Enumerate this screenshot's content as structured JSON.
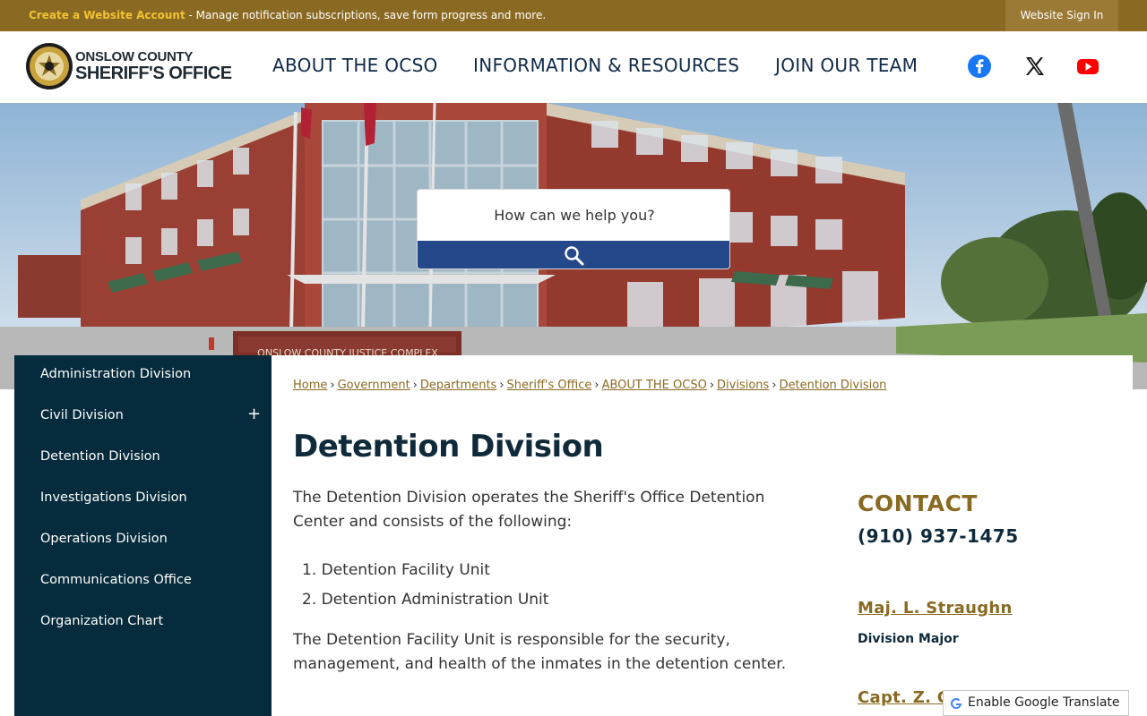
{
  "topbar": {
    "create_link": "Create a Website Account",
    "message": " - Manage notification subscriptions, save form progress and more.",
    "sign_in": "Website Sign In"
  },
  "header": {
    "logo_line1": "ONSLOW COUNTY",
    "logo_line2": "SHERIFF'S OFFICE",
    "nav": [
      "ABOUT THE OCSO",
      "INFORMATION & RESOURCES",
      "JOIN OUR TEAM"
    ],
    "social_icons": [
      "facebook-icon",
      "x-icon",
      "youtube-icon"
    ]
  },
  "hero": {
    "sign_text": "ONSLOW COUNTY JUSTICE COMPLEX"
  },
  "search": {
    "placeholder": "How can we help you?"
  },
  "sidebar": {
    "items": [
      {
        "label": "Administration Division"
      },
      {
        "label": "Civil Division",
        "expand": "+"
      },
      {
        "label": "Detention Division"
      },
      {
        "label": "Investigations Division"
      },
      {
        "label": "Operations Division"
      },
      {
        "label": "Communications Office"
      },
      {
        "label": "Organization Chart"
      }
    ]
  },
  "breadcrumb": [
    "Home",
    "Government",
    "Departments",
    "Sheriff's Office",
    "ABOUT THE OCSO",
    "Divisions",
    "Detention Division"
  ],
  "main": {
    "title": "Detention Division",
    "intro": "The Detention Division operates the Sheriff's Office Detention Center and consists of the following:",
    "list": [
      "1. Detention Facility Unit",
      "2. Detention Administration Unit"
    ],
    "para2": "The Detention Facility Unit is responsible for the security, management, and health of the inmates in the detention center."
  },
  "contact": {
    "title": "CONTACT",
    "phone": "(910) 937-1475",
    "person1_name": "Maj. L. Straughn",
    "person1_role": "Division Major",
    "person2_name": "Capt. Z. G"
  },
  "translate": {
    "label": "Enable Google Translate"
  },
  "colors": {
    "topbar": "#8a6a22",
    "sidebar": "#062b3c",
    "accent_gold": "#8a6a22",
    "search_button": "#24488a",
    "heading": "#0f2a3a"
  }
}
